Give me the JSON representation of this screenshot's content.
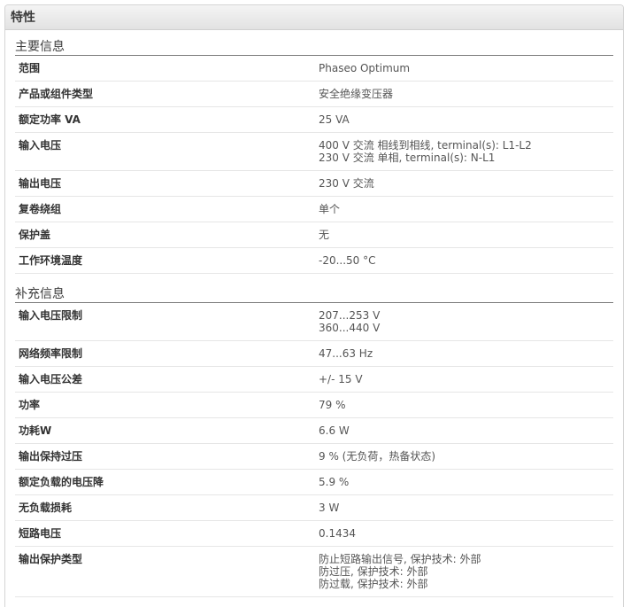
{
  "header": {
    "title": "特性"
  },
  "sections": [
    {
      "title": "主要信息",
      "rows": [
        {
          "label": "范围",
          "values": [
            "Phaseo Optimum"
          ]
        },
        {
          "label": "产品或组件类型",
          "values": [
            "安全绝缘变压器"
          ]
        },
        {
          "label": "额定功率 VA",
          "values": [
            "25 VA"
          ]
        },
        {
          "label": "输入电压",
          "values": [
            "400 V 交流 相线到相线, terminal(s): L1-L2",
            "230 V 交流 单相, terminal(s): N-L1"
          ]
        },
        {
          "label": "输出电压",
          "values": [
            "230 V 交流"
          ]
        },
        {
          "label": "复卷绕组",
          "values": [
            "单个"
          ]
        },
        {
          "label": "保护盖",
          "values": [
            "无"
          ]
        },
        {
          "label": "工作环境温度",
          "values": [
            "-20...50 °C"
          ]
        }
      ]
    },
    {
      "title": "补充信息",
      "rows": [
        {
          "label": "输入电压限制",
          "values": [
            "207...253 V",
            "360...440 V"
          ]
        },
        {
          "label": "网络频率限制",
          "values": [
            "47...63 Hz"
          ]
        },
        {
          "label": "输入电压公差",
          "values": [
            "+/- 15 V"
          ]
        },
        {
          "label": "功率",
          "values": [
            "79 %"
          ]
        },
        {
          "label": "功耗W",
          "values": [
            "6.6 W"
          ]
        },
        {
          "label": "输出保持过压",
          "values": [
            "9 % (无负荷，热备状态)"
          ]
        },
        {
          "label": "额定负载的电压降",
          "values": [
            "5.9 %"
          ]
        },
        {
          "label": "无负载损耗",
          "values": [
            "3 W"
          ]
        },
        {
          "label": "短路电压",
          "values": [
            "0.1434"
          ]
        },
        {
          "label": "输出保护类型",
          "values": [
            "防止短路输出信号, 保护技术: 外部",
            "防过压, 保护技术: 外部",
            "防过载, 保护技术: 外部"
          ]
        }
      ]
    }
  ]
}
